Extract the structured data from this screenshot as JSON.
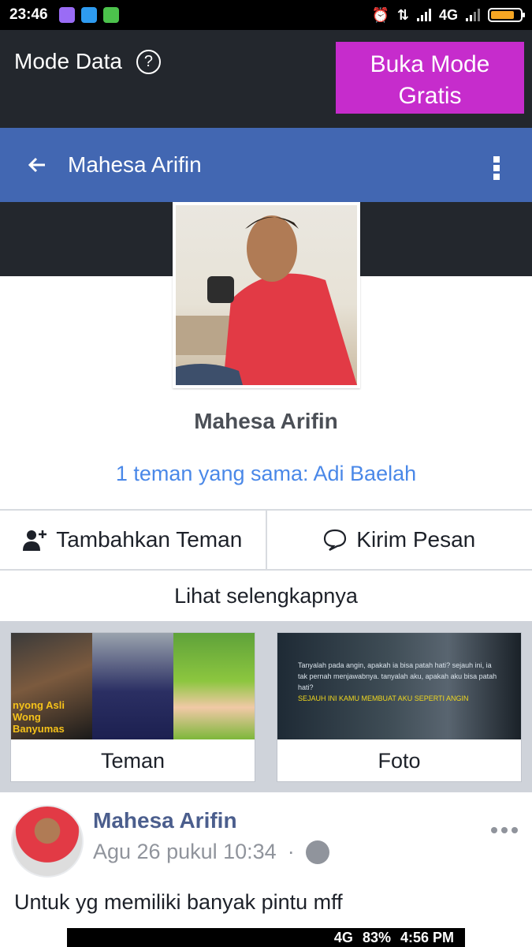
{
  "status_bar": {
    "time": "23:46",
    "network": "4G",
    "app_icon_colors": [
      "#9a6cf5",
      "#2e9bf0",
      "#4cc24c"
    ],
    "battery_color": "#f5a623"
  },
  "mode_bar": {
    "title": "Mode Data",
    "help_glyph": "?",
    "free_button": "Buka Mode Gratis",
    "accent": "#c62ccc"
  },
  "nav": {
    "title": "Mahesa Arifin",
    "color": "#4267b2"
  },
  "profile": {
    "name": "Mahesa Arifin",
    "mutual_friends": "1 teman yang sama: Adi Baelah"
  },
  "actions": {
    "add_friend": "Tambahkan Teman",
    "message": "Kirim Pesan"
  },
  "see_more": "Lihat selengkapnya",
  "cards": {
    "friends": "Teman",
    "photos": "Foto",
    "friend_thumb_text": "nyong Asli Wong Banyumas",
    "photo_thumb_text": "Tanyalah pada angin, apakah ia bisa patah hati? sejauh ini, ia tak pernah menjawabnya. tanyalah aku, apakah aku bisa patah hati?",
    "photo_thumb_caption": "SEJAUH INI KAMU MEMBUAT AKU SEPERTI ANGIN"
  },
  "post": {
    "author": "Mahesa Arifin",
    "time": "Agu 26 pukul 10:34",
    "separator": "·",
    "text": "Untuk yg memiliki banyak pintu mff",
    "embed_status": {
      "network": "4G",
      "battery": "83%",
      "time": "4:56 PM"
    }
  }
}
